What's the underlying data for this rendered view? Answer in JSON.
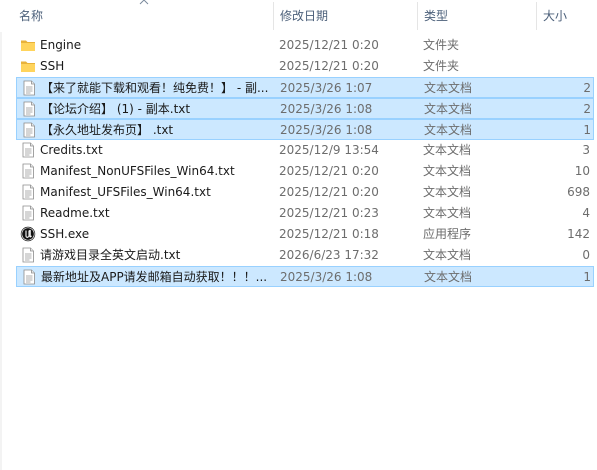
{
  "columns": {
    "name": "名称",
    "date": "修改日期",
    "type": "类型",
    "size": "大小"
  },
  "files": [
    {
      "icon": "folder-icon",
      "name": "Engine",
      "date": "2025/12/21 0:20",
      "type": "文件夹",
      "size": "",
      "selected": false
    },
    {
      "icon": "folder-icon",
      "name": "SSH",
      "date": "2025/12/21 0:20",
      "type": "文件夹",
      "size": "",
      "selected": false
    },
    {
      "icon": "text-file-icon",
      "name": "【来了就能下载和观看！纯免费！】 - 副...",
      "date": "2025/3/26 1:07",
      "type": "文本文档",
      "size": "2",
      "selected": true
    },
    {
      "icon": "text-file-icon",
      "name": "【论坛介绍】 (1) - 副本.txt",
      "date": "2025/3/26 1:08",
      "type": "文本文档",
      "size": "2",
      "selected": true
    },
    {
      "icon": "text-file-icon",
      "name": "【永久地址发布页】 .txt",
      "date": "2025/3/26 1:08",
      "type": "文本文档",
      "size": "1",
      "selected": true
    },
    {
      "icon": "text-file-icon",
      "name": "Credits.txt",
      "date": "2025/12/9 13:54",
      "type": "文本文档",
      "size": "3",
      "selected": false
    },
    {
      "icon": "text-file-icon",
      "name": "Manifest_NonUFSFiles_Win64.txt",
      "date": "2025/12/21 0:20",
      "type": "文本文档",
      "size": "10",
      "selected": false
    },
    {
      "icon": "text-file-icon",
      "name": "Manifest_UFSFiles_Win64.txt",
      "date": "2025/12/21 0:20",
      "type": "文本文档",
      "size": "698",
      "selected": false
    },
    {
      "icon": "text-file-icon",
      "name": "Readme.txt",
      "date": "2025/12/21 0:23",
      "type": "文本文档",
      "size": "4",
      "selected": false
    },
    {
      "icon": "unreal-app-icon",
      "name": "SSH.exe",
      "date": "2025/12/21 0:18",
      "type": "应用程序",
      "size": "142",
      "selected": false
    },
    {
      "icon": "text-file-icon",
      "name": "请游戏目录全英文启动.txt",
      "date": "2026/6/23 17:32",
      "type": "文本文档",
      "size": "0",
      "selected": false
    },
    {
      "icon": "text-file-icon",
      "name": "最新地址及APP请发邮箱自动获取！！！...",
      "date": "2025/3/26 1:08",
      "type": "文本文档",
      "size": "1",
      "selected": true
    }
  ],
  "colors": {
    "selection_bg": "#cce8ff",
    "selection_border": "#99d1ff",
    "folder": "#ffd45c",
    "header_text": "#4c607a"
  }
}
